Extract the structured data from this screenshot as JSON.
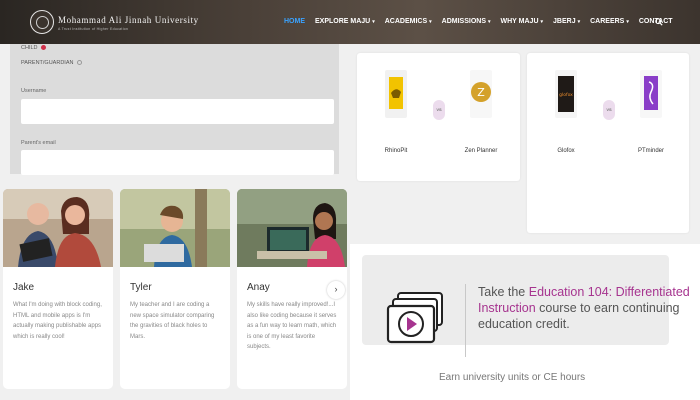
{
  "header": {
    "logo_name": "Mohammad Ali Jinnah University",
    "logo_tagline": "A Trust Institution of Higher Education",
    "nav": [
      {
        "label": "HOME",
        "active": true,
        "has_caret": false
      },
      {
        "label": "EXPLORE MAJU",
        "active": false,
        "has_caret": true
      },
      {
        "label": "ACADEMICS",
        "active": false,
        "has_caret": true
      },
      {
        "label": "ADMISSIONS",
        "active": false,
        "has_caret": true
      },
      {
        "label": "WHY MAJU",
        "active": false,
        "has_caret": true
      },
      {
        "label": "JBERJ",
        "active": false,
        "has_caret": true
      },
      {
        "label": "CAREERS",
        "active": false,
        "has_caret": true
      },
      {
        "label": "CONTACT",
        "active": false,
        "has_caret": false
      }
    ],
    "search_icon": "search-icon"
  },
  "login": {
    "option_child": "CHILD",
    "option_parent": "PARENT/GUARDIAN",
    "selected": "CHILD",
    "username_label": "Username",
    "username_value": "",
    "email_label": "Parent's email",
    "email_value": ""
  },
  "testimonials": [
    {
      "name": "Jake",
      "quote": "What I'm doing with block coding, HTML and mobile apps is I'm actually making publishable apps which is really cool!"
    },
    {
      "name": "Tyler",
      "quote": "My teacher and I are coding a new space simulator comparing the gravities of black holes to Mars."
    },
    {
      "name": "Anay",
      "quote": "My skills have really improved!...I also like coding because it serves as a fun way to learn math, which is one of my least favorite subjects."
    }
  ],
  "carousel_next": "›",
  "comparisons": [
    {
      "left": "RhinoPit",
      "vs": "VS",
      "right": "Zen Planner"
    },
    {
      "left": "Glofox",
      "vs": "VS",
      "right": "PTminder"
    }
  ],
  "education": {
    "prefix": "Take the ",
    "highlight": "Education 104: Differentiated Instruction",
    "suffix": " course to earn continuing education credit.",
    "subtext": "Earn university units or CE hours",
    "icon": "video-course-icon"
  },
  "colors": {
    "nav_active": "#3aa3ff",
    "accent_magenta": "#a6348f",
    "radio_selected": "#d0304a"
  }
}
